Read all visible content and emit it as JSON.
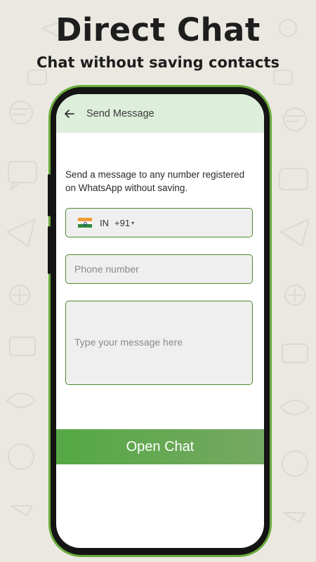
{
  "promo": {
    "title": "Direct Chat",
    "subtitle": "Chat without saving contacts"
  },
  "appbar": {
    "back_icon": "arrow-back-icon",
    "title": "Send Message"
  },
  "description": "Send a message to any number registered on WhatsApp without saving.",
  "country_selector": {
    "flag_icon": "india-flag-icon",
    "country_code": "IN",
    "dial_code": "+91",
    "caret_icon": "dropdown-caret-icon"
  },
  "phone_input": {
    "placeholder": "Phone number",
    "value": ""
  },
  "message_input": {
    "placeholder": "Type your message here",
    "value": ""
  },
  "open_chat_button": {
    "label": "Open Chat"
  },
  "colors": {
    "background": "#ebe8e1",
    "phone_frame_accent": "#6aab3c",
    "appbar_bg": "#ddeedb",
    "field_border": "#4d8a2f",
    "button_start": "#55a845",
    "button_end": "#76a862"
  }
}
